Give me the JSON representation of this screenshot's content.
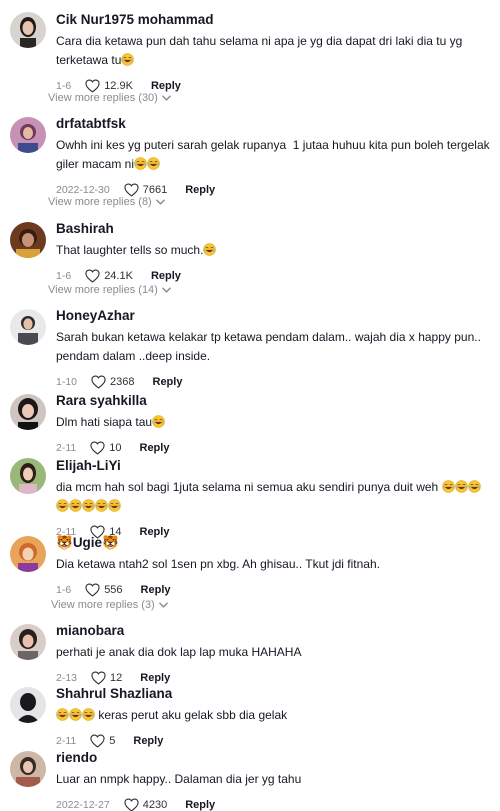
{
  "comments": [
    {
      "username": "Cik Nur1975 mohammad",
      "text": "Cara dia ketawa pun dah tahu selama ni apa je yg dia dapat dri laki dia tu yg terketawa tu",
      "emoji_count": 1,
      "date": "1-6",
      "likes": "12.9K",
      "reply": "Reply",
      "view_more": "View more replies (30)"
    },
    {
      "username": "drfatabtfsk",
      "text": "Owhh ini kes yg puteri sarah gelak rupanya  1 jutaa huhuu kita pun boleh tergelak giler macam ni",
      "emoji_count": 2,
      "date": "2022-12-30",
      "likes": "7661",
      "reply": "Reply",
      "view_more": "View more replies (8)"
    },
    {
      "username": "Bashirah",
      "text": "That laughter tells so much.",
      "emoji_count": 1,
      "date": "1-6",
      "likes": "24.1K",
      "reply": "Reply",
      "view_more": "View more replies (14)"
    },
    {
      "username": "HoneyAzhar",
      "text": "Sarah bukan ketawa kelakar tp ketawa pendam dalam.. wajah dia x happy pun.. pendam dalam ..deep inside.",
      "emoji_count": 0,
      "date": "1-10",
      "likes": "2368",
      "reply": "Reply",
      "view_more": ""
    },
    {
      "username": "Rara syahkilla",
      "text": "Dlm hati siapa tau",
      "emoji_count": 1,
      "date": "2-11",
      "likes": "10",
      "reply": "Reply",
      "view_more": ""
    },
    {
      "username": "Elijah-LiYi",
      "text": "dia mcm hah sol bagi 1juta selama ni semua aku sendiri punya duit weh",
      "emoji_count": 8,
      "date": "2-11",
      "likes": "14",
      "reply": "Reply",
      "view_more": ""
    },
    {
      "username": "Ugie",
      "text": "Dia ketawa ntah2 sol 1sen pn xbg. Ah ghisau.. Tkut jdi fitnah.",
      "emoji_count": 0,
      "date": "1-6",
      "likes": "556",
      "reply": "Reply",
      "view_more": "View more replies (3)"
    },
    {
      "username": "mianobara",
      "text": "perhati je anak dia dok lap lap muka HAHAHA",
      "emoji_count": 0,
      "date": "2-13",
      "likes": "12",
      "reply": "Reply",
      "view_more": ""
    },
    {
      "username": "Shahrul Shazliana",
      "text": "keras perut aku gelak sbb dia gelak",
      "emoji_count": 3,
      "date": "2-11",
      "likes": "5",
      "reply": "Reply",
      "view_more": ""
    },
    {
      "username": "riendo",
      "text": "Luar an nmpk happy.. Dalaman dia jer yg tahu",
      "emoji_count": 0,
      "date": "2022-12-27",
      "likes": "4230",
      "reply": "Reply",
      "view_more": ""
    }
  ],
  "colors": {
    "text": "#161823",
    "muted": "#8a8b91",
    "background": "#ffffff"
  },
  "icons": {
    "like": "heart-outline-icon",
    "expand": "chevron-down-icon",
    "emoji": "laughing-emoji-icon"
  }
}
